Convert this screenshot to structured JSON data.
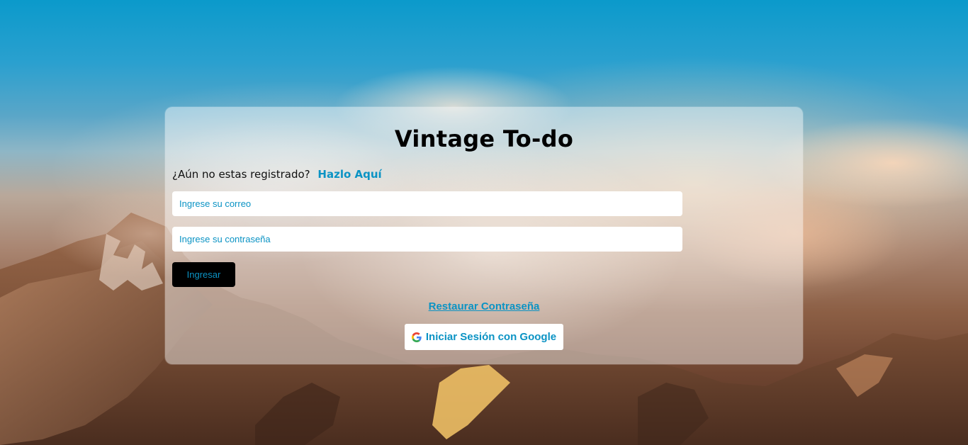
{
  "app": {
    "title": "Vintage To-do"
  },
  "register": {
    "prompt": "¿Aún no estas registrado?",
    "link_label": "Hazlo Aquí"
  },
  "form": {
    "email_placeholder": "Ingrese su correo",
    "password_placeholder": "Ingrese su contraseña",
    "submit_label": "Ingresar"
  },
  "links": {
    "restore_password": "Restaurar Contraseña",
    "google_login": "Iniciar Sesión con Google"
  },
  "icons": {
    "google": "google-icon"
  },
  "colors": {
    "accent": "#0b93c4",
    "button_bg": "#000000",
    "card_bg": "rgba(255,255,255,0.45)"
  }
}
